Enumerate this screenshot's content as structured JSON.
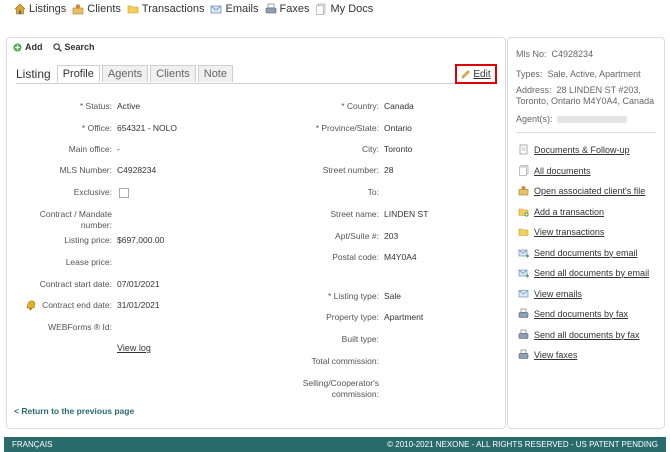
{
  "nav": {
    "listings": "Listings",
    "clients": "Clients",
    "transactions": "Transactions",
    "emails": "Emails",
    "faxes": "Faxes",
    "mydocs": "My Docs"
  },
  "toolbar": {
    "add": "Add",
    "search": "Search"
  },
  "tabs": {
    "title": "Listing",
    "profile": "Profile",
    "agents": "Agents",
    "clients": "Clients",
    "note": "Note"
  },
  "edit_label": "Edit",
  "left_fields": [
    {
      "label": "* Status:",
      "value": "Active"
    },
    {
      "label": "* Office:",
      "value": "654321 - NOLO"
    },
    {
      "label": "Main office:",
      "value": "-"
    },
    {
      "label": "MLS Number:",
      "value": "C4928234"
    },
    {
      "label": "Exclusive:",
      "value": ""
    },
    {
      "label": "Contract / Mandate number:",
      "value": ""
    },
    {
      "label": "Listing price:",
      "value": "$697,000.00"
    },
    {
      "label": "Lease price:",
      "value": ""
    },
    {
      "label": "Contract start date:",
      "value": "07/01/2021"
    },
    {
      "label": "Contract end date:",
      "value": "31/01/2021"
    },
    {
      "label": "WEBForms ® Id:",
      "value": ""
    }
  ],
  "view_log": "View log",
  "right_fields": [
    {
      "label": "* Country:",
      "value": "Canada"
    },
    {
      "label": "* Province/State:",
      "value": "Ontario"
    },
    {
      "label": "City:",
      "value": "Toronto"
    },
    {
      "label": "Street number:",
      "value": "28"
    },
    {
      "label": "To:",
      "value": ""
    },
    {
      "label": "Street name:",
      "value": "LINDEN ST"
    },
    {
      "label": "Apt/Suite #:",
      "value": "203"
    },
    {
      "label": "Postal code:",
      "value": "M4Y0A4"
    },
    {
      "label": "* Listing type:",
      "value": "Sale"
    },
    {
      "label": "Property type:",
      "value": "Apartment"
    },
    {
      "label": "Built type:",
      "value": ""
    },
    {
      "label": "Total commission:",
      "value": ""
    },
    {
      "label": "Selling/Cooperator's commission:",
      "value": ""
    }
  ],
  "return_link": "< Return to the previous page",
  "side": {
    "mls_label": "Mls No:",
    "mls_value": "C4928234",
    "types_label": "Types:",
    "types_value": "Sale, Active, Apartment",
    "address_label": "Address:",
    "address_line1": "28 LINDEN ST #203,",
    "address_line2": "Toronto, Ontario M4Y0A4, Canada",
    "agent_label": "Agent(s):",
    "links": [
      {
        "text": "Documents & Follow-up",
        "icon": "document-icon"
      },
      {
        "text": "All documents",
        "icon": "documents-icon"
      },
      {
        "text": "Open associated client's file",
        "icon": "client-file-icon"
      },
      {
        "text": "Add a transaction",
        "icon": "add-folder-icon"
      },
      {
        "text": "View transactions",
        "icon": "folder-icon"
      },
      {
        "text": "Send documents by email",
        "icon": "email-send-icon"
      },
      {
        "text": "Send all documents by email",
        "icon": "email-send-all-icon"
      },
      {
        "text": "View emails",
        "icon": "email-icon"
      },
      {
        "text": "Send documents by fax",
        "icon": "fax-send-icon"
      },
      {
        "text": "Send all documents by fax",
        "icon": "fax-send-all-icon"
      },
      {
        "text": "View faxes",
        "icon": "fax-icon"
      }
    ]
  },
  "footer": {
    "language": "FRANÇAIS",
    "copyright": "© 2010-2021 NEXONE - ALL RIGHTS RESERVED - US PATENT PENDING"
  },
  "colors": {
    "accent": "#2a6b6b",
    "highlight_border": "#e00000"
  }
}
